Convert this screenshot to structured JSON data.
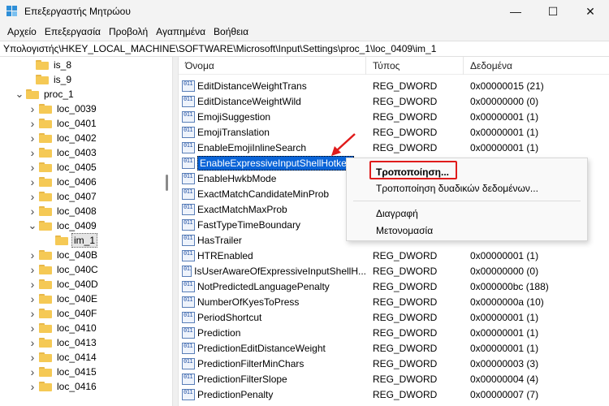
{
  "window": {
    "title": "Επεξεργαστής Μητρώου",
    "controls": {
      "minimize": "—",
      "maximize": "☐",
      "close": "✕"
    }
  },
  "menu": [
    "Αρχείο",
    "Επεξεργασία",
    "Προβολή",
    "Αγαπημένα",
    "Βοήθεια"
  ],
  "address": "Υπολογιστής\\HKEY_LOCAL_MACHINE\\SOFTWARE\\Microsoft\\Input\\Settings\\proc_1\\loc_0409\\im_1",
  "tree": [
    {
      "label": "is_8",
      "chevron": "",
      "selected": false
    },
    {
      "label": "is_9",
      "chevron": "",
      "selected": false
    },
    {
      "label": "proc_1",
      "chevron": "expanded",
      "selected": false
    },
    {
      "label": "loc_0039",
      "chevron": "collapsed",
      "selected": false
    },
    {
      "label": "loc_0401",
      "chevron": "collapsed",
      "selected": false
    },
    {
      "label": "loc_0402",
      "chevron": "collapsed",
      "selected": false
    },
    {
      "label": "loc_0403",
      "chevron": "collapsed",
      "selected": false
    },
    {
      "label": "loc_0405",
      "chevron": "collapsed",
      "selected": false
    },
    {
      "label": "loc_0406",
      "chevron": "collapsed",
      "selected": false
    },
    {
      "label": "loc_0407",
      "chevron": "collapsed",
      "selected": false
    },
    {
      "label": "loc_0408",
      "chevron": "collapsed",
      "selected": false
    },
    {
      "label": "loc_0409",
      "chevron": "expanded",
      "selected": false
    },
    {
      "label": "im_1",
      "chevron": "",
      "selected": true
    },
    {
      "label": "loc_040B",
      "chevron": "collapsed",
      "selected": false
    },
    {
      "label": "loc_040C",
      "chevron": "collapsed",
      "selected": false
    },
    {
      "label": "loc_040D",
      "chevron": "collapsed",
      "selected": false
    },
    {
      "label": "loc_040E",
      "chevron": "collapsed",
      "selected": false
    },
    {
      "label": "loc_040F",
      "chevron": "collapsed",
      "selected": false
    },
    {
      "label": "loc_0410",
      "chevron": "collapsed",
      "selected": false
    },
    {
      "label": "loc_0413",
      "chevron": "collapsed",
      "selected": false
    },
    {
      "label": "loc_0414",
      "chevron": "collapsed",
      "selected": false
    },
    {
      "label": "loc_0415",
      "chevron": "collapsed",
      "selected": false
    },
    {
      "label": "loc_0416",
      "chevron": "collapsed",
      "selected": false
    }
  ],
  "columns": {
    "name": "Όνομα",
    "type": "Τύπος",
    "data": "Δεδομένα"
  },
  "values": [
    {
      "name": "EditDistanceWeightTrans",
      "type": "REG_DWORD",
      "data": "0x00000015 (21)"
    },
    {
      "name": "EditDistanceWeightWild",
      "type": "REG_DWORD",
      "data": "0x00000000 (0)"
    },
    {
      "name": "EmojiSuggestion",
      "type": "REG_DWORD",
      "data": "0x00000001 (1)"
    },
    {
      "name": "EmojiTranslation",
      "type": "REG_DWORD",
      "data": "0x00000001 (1)"
    },
    {
      "name": "EnableEmojiInlineSearch",
      "type": "REG_DWORD",
      "data": "0x00000001 (1)"
    },
    {
      "name": "EnableExpressiveInputShellHotkey",
      "type": "",
      "data": ""
    },
    {
      "name": "EnableHwkbMode",
      "type": "",
      "data": ""
    },
    {
      "name": "ExactMatchCandidateMinProb",
      "type": "",
      "data": ""
    },
    {
      "name": "ExactMatchMaxProb",
      "type": "",
      "data": ""
    },
    {
      "name": "FastTypeTimeBoundary",
      "type": "",
      "data": ""
    },
    {
      "name": "HasTrailer",
      "type": "",
      "data": ""
    },
    {
      "name": "HTREnabled",
      "type": "REG_DWORD",
      "data": "0x00000001 (1)"
    },
    {
      "name": "IsUserAwareOfExpressiveInputShellH...",
      "type": "REG_DWORD",
      "data": "0x00000000 (0)"
    },
    {
      "name": "NotPredictedLanguagePenalty",
      "type": "REG_DWORD",
      "data": "0x000000bc (188)"
    },
    {
      "name": "NumberOfKyesToPress",
      "type": "REG_DWORD",
      "data": "0x0000000a (10)"
    },
    {
      "name": "PeriodShortcut",
      "type": "REG_DWORD",
      "data": "0x00000001 (1)"
    },
    {
      "name": "Prediction",
      "type": "REG_DWORD",
      "data": "0x00000001 (1)"
    },
    {
      "name": "PredictionEditDistanceWeight",
      "type": "REG_DWORD",
      "data": "0x00000001 (1)"
    },
    {
      "name": "PredictionFilterMinChars",
      "type": "REG_DWORD",
      "data": "0x00000003 (3)"
    },
    {
      "name": "PredictionFilterSlope",
      "type": "REG_DWORD",
      "data": "0x00000004 (4)"
    },
    {
      "name": "PredictionPenalty",
      "type": "REG_DWORD",
      "data": "0x00000007 (7)"
    }
  ],
  "selected_value_index": 5,
  "context_menu": {
    "modify": "Τροποποίηση...",
    "modify_binary": "Τροποποίηση δυαδικών δεδομένων...",
    "delete": "Διαγραφή",
    "rename": "Μετονομασία"
  },
  "colors": {
    "selection": "#0a64d8",
    "highlight_box": "#e01b1b",
    "folder": "#f5c955"
  }
}
